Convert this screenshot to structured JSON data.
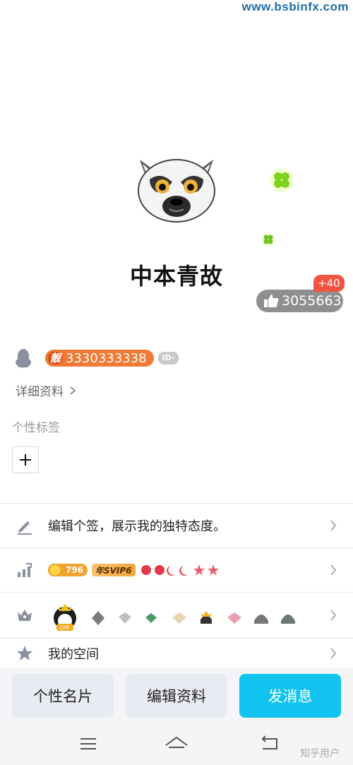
{
  "watermark": {
    "top": "www.bsbinfx.com",
    "bottom": "知乎用户"
  },
  "profile": {
    "nickname": "中本青故",
    "likes": "3055663",
    "likes_increment": "+40",
    "qq_number": "3330333338",
    "pretty_number_tag": "靓",
    "id_tag": "ID"
  },
  "details": {
    "link_label": "详细资料"
  },
  "tags": {
    "title": "个性标签",
    "add_label": "+"
  },
  "rows": {
    "signature": {
      "label": "编辑个签，展示我的独特态度。"
    },
    "level": {
      "level_value": "796",
      "svip_label": "年SVIP6"
    },
    "space": {
      "label": "我的空间"
    }
  },
  "actions": {
    "card_label": "个性名片",
    "edit_label": "编辑资料",
    "message_label": "发消息"
  },
  "colors": {
    "accent": "#11c4f0",
    "qq_number_bg": "#f07a33",
    "like_badge": "#f0533f",
    "like_pill": "#8f8f8f"
  },
  "icons": {
    "nav_menu": "menu-icon",
    "nav_home": "home-icon",
    "nav_back": "back-icon"
  }
}
